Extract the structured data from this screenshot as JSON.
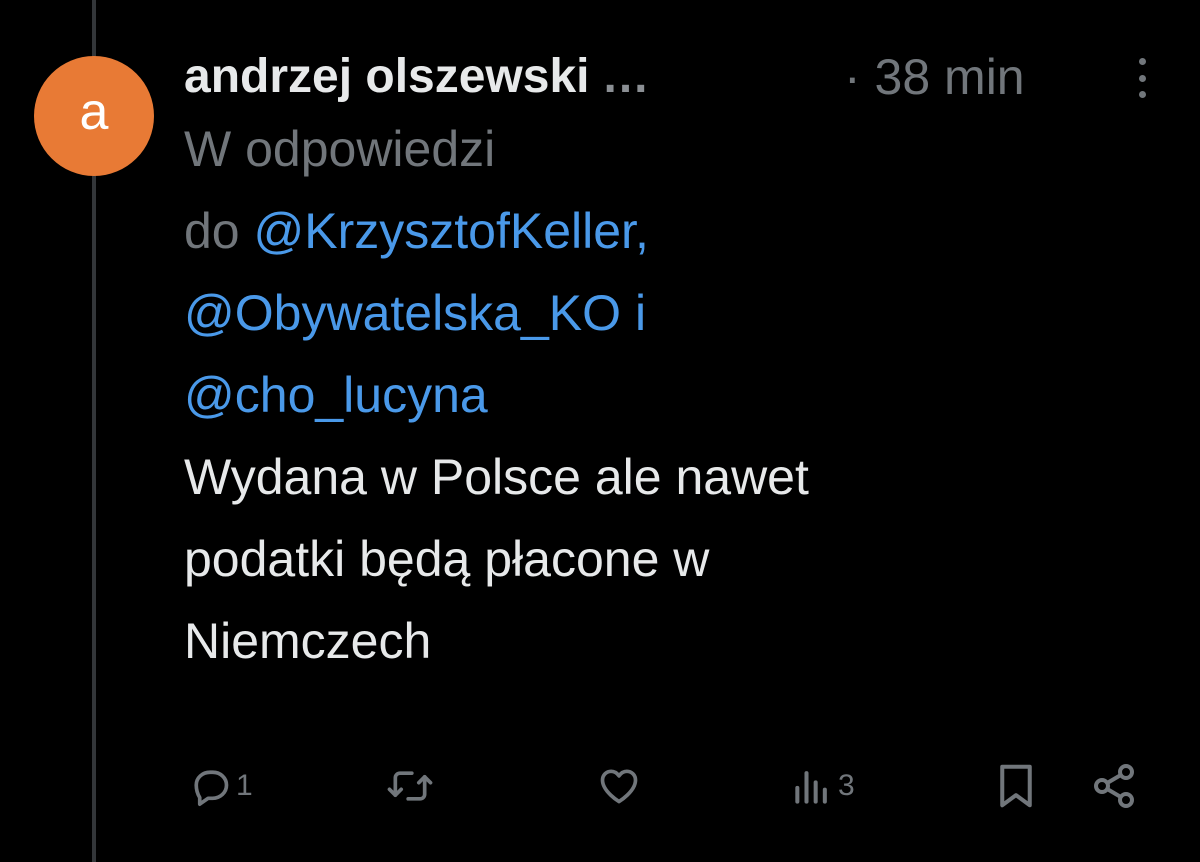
{
  "tweet": {
    "avatar_letter": "a",
    "author": "andrzej olszewski",
    "author_ellipsis": "...",
    "time": "· 38 min",
    "reply_prefix": "W odpowiedzi",
    "reply_do": "do",
    "mentions": [
      "@KrzysztofKeller,",
      "@Obywatelska_KO",
      "@cho_lucyna"
    ],
    "mention_joiner": "i",
    "body_lines": [
      "Wydana w Polsce ale nawet",
      "podatki będą płacone w",
      "Niemczech"
    ]
  },
  "actions": {
    "reply_count": "1",
    "views_count": "3"
  },
  "icons": {
    "more": "more-vertical-icon",
    "reply": "reply-icon",
    "retweet": "retweet-icon",
    "like": "heart-icon",
    "views": "views-icon",
    "bookmark": "bookmark-icon",
    "share": "share-icon"
  },
  "colors": {
    "background": "#000000",
    "avatar": "#e87a35",
    "mention": "#4a99e9",
    "secondary_text": "#71767b",
    "primary_text": "#e7e9ea"
  }
}
